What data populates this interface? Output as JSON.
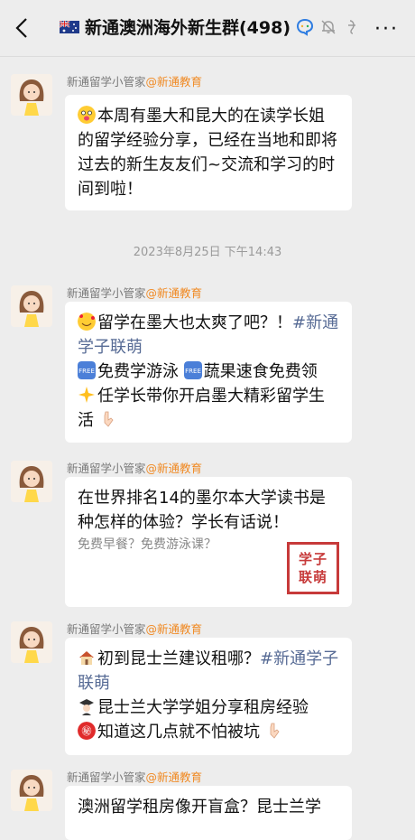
{
  "header": {
    "title": "新通澳洲海外新生群(498)",
    "flag_icon": "australia-flag-icon",
    "more_label": "···"
  },
  "messages": [
    {
      "sender_name": "新通留学小管家",
      "sender_org": "@新通教育",
      "text": "本周有墨大和昆大的在读学长姐的留学经验分享，已经在当地和即将过去的新生友友们~交流和学习的时间到啦！"
    },
    {
      "sender_name": "新通留学小管家",
      "sender_org": "@新通教育",
      "line1": "留学在墨大也太爽了吧？！",
      "tag": "#新通学子联萌",
      "line2": "免费学游泳",
      "line3": "蔬果速食免费领",
      "line4": "任学长带你开启墨大精彩留学生活"
    },
    {
      "sender_name": "新通留学小管家",
      "sender_org": "@新通教育",
      "card_title": "在世界排名14的墨尔本大学读书是种怎样的体验？学长有话说！",
      "card_sub": "免费早餐？免费游泳课？",
      "card_logo_line1": "学子",
      "card_logo_line2": "联萌"
    },
    {
      "sender_name": "新通留学小管家",
      "sender_org": "@新通教育",
      "line1": "初到昆士兰建议租哪？",
      "tag": "#新通学子联萌",
      "line2": "昆士兰大学学姐分享租房经验",
      "line3": "知道这几点就不怕被坑"
    },
    {
      "sender_name": "新通留学小管家",
      "sender_org": "@新通教育",
      "text": "澳洲留学租房像开盲盒？昆士兰学"
    }
  ],
  "timestamp": "2023年8月25日 下午14:43",
  "colors": {
    "tag": "#576b95",
    "org": "#f08a24",
    "background": "#ededed"
  }
}
